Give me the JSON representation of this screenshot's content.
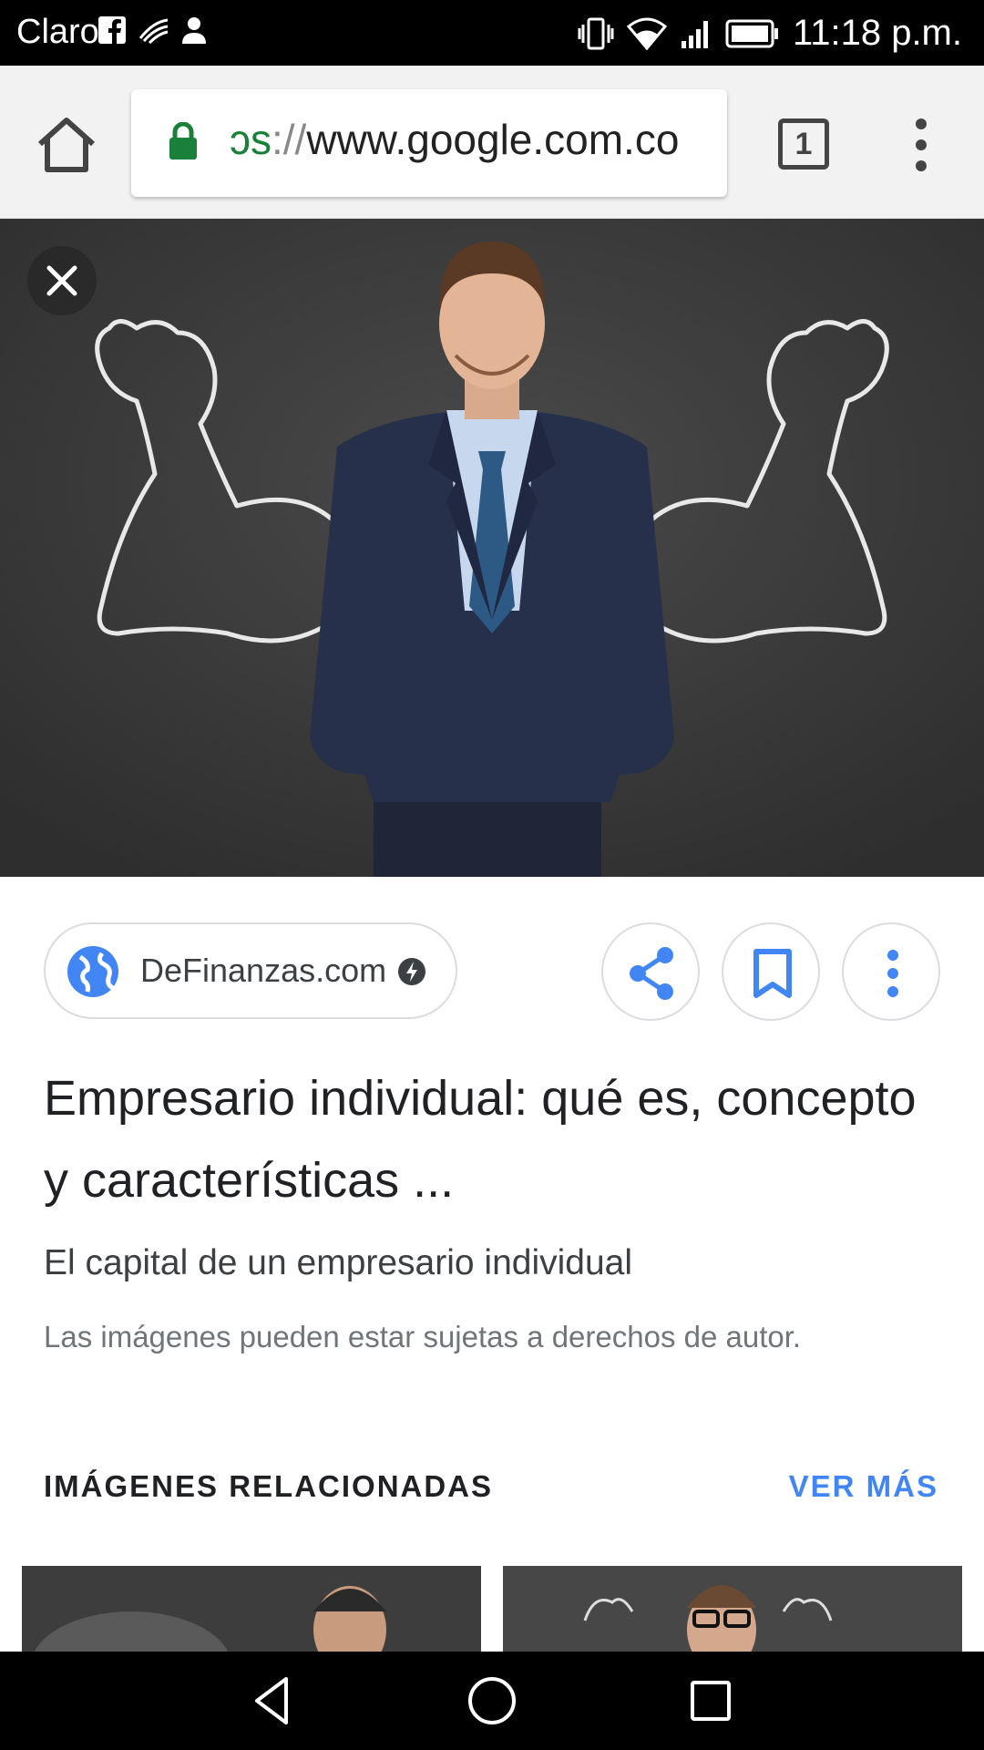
{
  "status_bar": {
    "carrier": "Claro",
    "time": "11:18 p.m."
  },
  "browser": {
    "url_scheme": "ɔs",
    "url_separator": "://",
    "url_host": "www.google.com.co",
    "tab_count": "1"
  },
  "result": {
    "source_site": "DeFinanzas.com",
    "title": "Empresario individual: qué es, concepto y características ...",
    "subtitle": "El capital de un empresario individual",
    "copyright_notice": "Las imágenes pueden estar sujetas a derechos de autor."
  },
  "related": {
    "heading": "IMÁGENES RELACIONADAS",
    "see_more": "VER MÁS"
  },
  "colors": {
    "accent_blue": "#4285f4",
    "lock_green": "#188038",
    "chalkboard": "#3a3a3a"
  },
  "icons": [
    "home-icon",
    "lock-icon",
    "tabs-icon",
    "overflow-menu-icon",
    "close-icon",
    "globe-icon",
    "amp-bolt-icon",
    "share-icon",
    "bookmark-icon",
    "more-vert-icon",
    "back-icon",
    "home-circle-icon",
    "recents-icon"
  ]
}
